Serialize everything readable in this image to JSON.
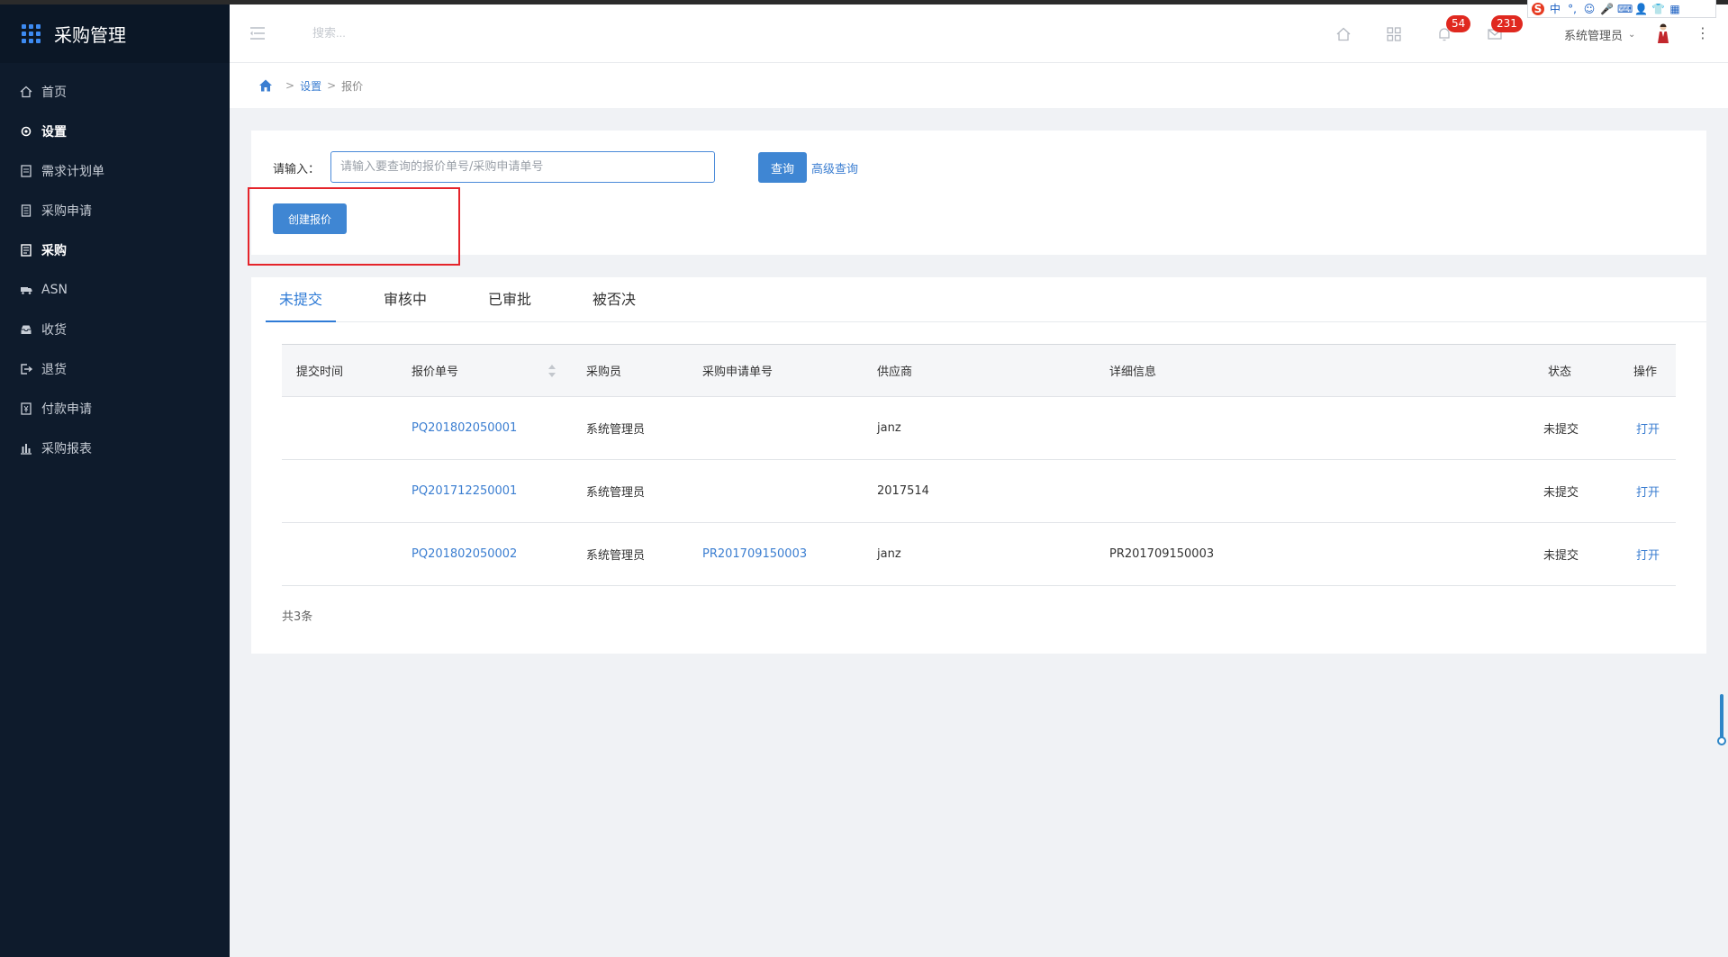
{
  "app": {
    "title": "采购管理"
  },
  "sidebar": {
    "items": [
      {
        "label": "首页",
        "icon": "home-icon"
      },
      {
        "label": "设置",
        "icon": "gear-icon"
      },
      {
        "label": "需求计划单",
        "icon": "document-icon"
      },
      {
        "label": "采购申请",
        "icon": "form-icon"
      },
      {
        "label": "采购",
        "icon": "list-icon"
      },
      {
        "label": "ASN",
        "icon": "truck-icon"
      },
      {
        "label": "收货",
        "icon": "inbox-icon"
      },
      {
        "label": "退货",
        "icon": "return-icon"
      },
      {
        "label": "付款申请",
        "icon": "payment-icon"
      },
      {
        "label": "采购报表",
        "icon": "bar-chart-icon"
      }
    ]
  },
  "header": {
    "search_placeholder": "搜索...",
    "notifications_count": "54",
    "messages_count": "231",
    "user_name": "系统管理员"
  },
  "breadcrumb": {
    "level1": "设置",
    "level2": "报价"
  },
  "query": {
    "label": "请输入：",
    "input_placeholder": "请输入要查询的报价单号/采购申请单号",
    "query_button": "查询",
    "advanced_link": "高级查询",
    "create_button": "创建报价"
  },
  "tabs": [
    {
      "label": "未提交",
      "active": true
    },
    {
      "label": "审核中"
    },
    {
      "label": "已审批"
    },
    {
      "label": "被否决"
    }
  ],
  "table": {
    "columns": [
      "提交时间",
      "报价单号",
      "采购员",
      "采购申请单号",
      "供应商",
      "详细信息",
      "状态",
      "操作"
    ],
    "rows": [
      {
        "submit_time": "",
        "quote_no": "PQ201802050001",
        "buyer": "系统管理员",
        "pr_no": "",
        "supplier": "janz",
        "detail": "",
        "status": "未提交",
        "action": "打开"
      },
      {
        "submit_time": "",
        "quote_no": "PQ201712250001",
        "buyer": "系统管理员",
        "pr_no": "",
        "supplier": "2017514",
        "detail": "",
        "status": "未提交",
        "action": "打开"
      },
      {
        "submit_time": "",
        "quote_no": "PQ201802050002",
        "buyer": "系统管理员",
        "pr_no": "PR201709150003",
        "supplier": "janz",
        "detail": "PR201709150003",
        "status": "未提交",
        "action": "打开"
      }
    ],
    "total": "共3条"
  },
  "colors": {
    "sidebar_bg": "#0e1b2c",
    "accent": "#3f86d3",
    "badge": "#e0281f",
    "highlight_box": "#e5242b"
  }
}
